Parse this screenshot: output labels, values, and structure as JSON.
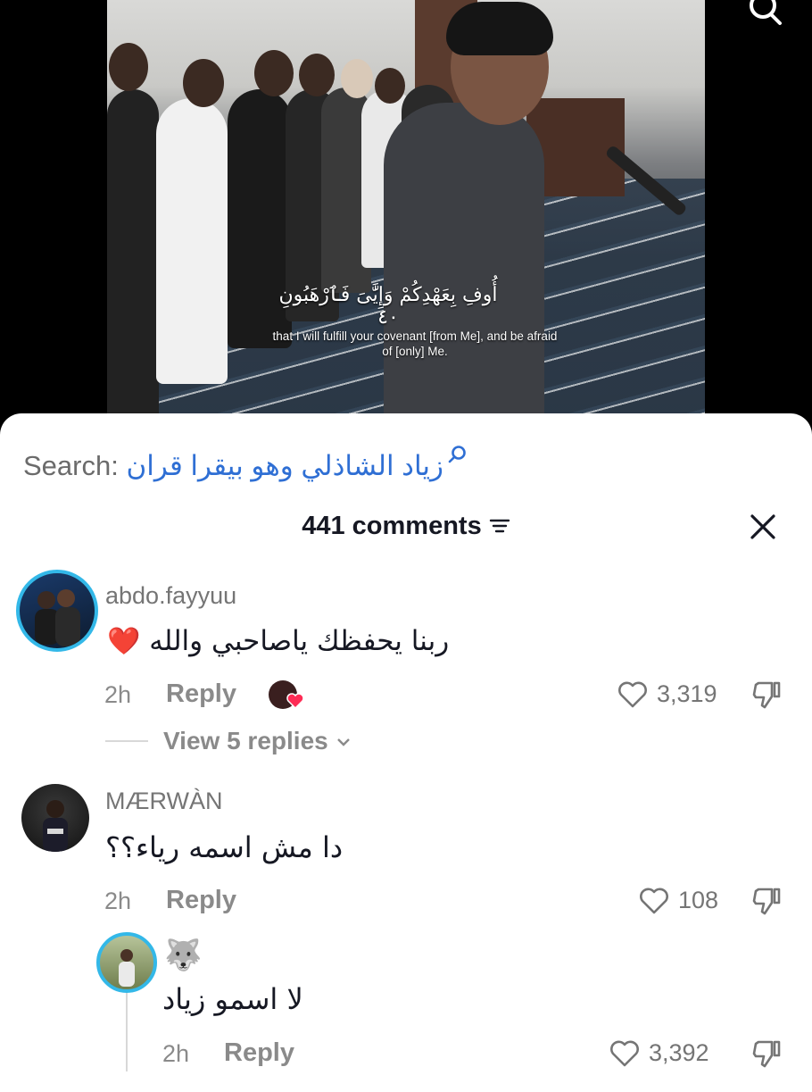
{
  "video": {
    "subtitle_arabic": "أُوفِ بِعَهْدِكُمْ وَإِيَّٰىَ فَٱرْهَبُونِ ٤٠",
    "subtitle_english": "that I will fulfill your covenant [from Me], and be afraid of [only] Me."
  },
  "search": {
    "label": "Search:",
    "query": "زياد الشاذلي وهو بيقرا قران"
  },
  "comments_header": {
    "title": "441 comments"
  },
  "comments": [
    {
      "username": "abdo.fayyuu",
      "text": "ربنا يحفظك ياصاحبي والله",
      "emoji": "❤️",
      "time": "2h",
      "reply_label": "Reply",
      "likes": "3,319",
      "view_replies": "View 5 replies"
    },
    {
      "username": "MÆRWÀN",
      "text": "دا مش اسمه رياء؟؟",
      "time": "2h",
      "reply_label": "Reply",
      "likes": "108"
    }
  ],
  "reply_comment": {
    "username_emoji": "🐺",
    "text": "لا اسمو زياد",
    "time": "2h",
    "reply_label": "Reply",
    "likes": "3,392"
  }
}
